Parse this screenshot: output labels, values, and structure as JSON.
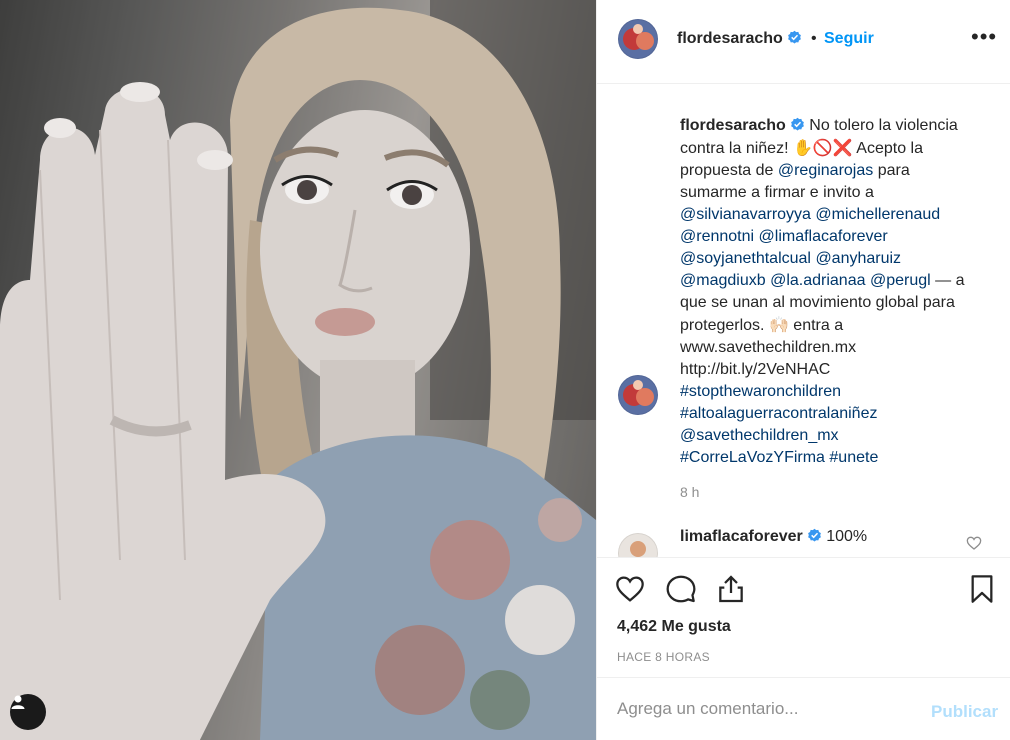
{
  "post": {
    "username": "flordesaracho",
    "separator": "•",
    "follow_label": "Seguir",
    "more_label": "•••",
    "caption": {
      "username": "flordesaracho",
      "text_1": "No tolero la violencia contra la niñez! ",
      "emoji_1": "✋🚫❌",
      "text_2": " Acepto la propuesta de ",
      "mention_1": "@reginarojas",
      "text_3": " para sumarme a firmar e invito a ",
      "mention_2": "@silvianavarroyya",
      "mention_3": "@michellerenaud",
      "mention_4": "@rennotni",
      "mention_5": "@limaflacaforever",
      "mention_6": "@soyjanethtalcual",
      "mention_7": "@anyharuiz",
      "mention_8": "@magdiuxb",
      "mention_9": "@la.adrianaa",
      "mention_10": "@perugl",
      "text_4": " — a que se unan al movimiento global para protegerlos. ",
      "emoji_2": "🙌🏻",
      "text_5": " entra a www.savethechildren.mx http://bit.ly/2VeNHAC ",
      "hashtag_1": "#stopthewaronchildren",
      "hashtag_2": "#altoalaguerracontralaniñez",
      "mention_11": "@savethechildren_mx",
      "hashtag_3": "#CorreLaVozYFirma",
      "hashtag_4": "#unete"
    },
    "caption_time": "8 h",
    "comment": {
      "username": "limaflacaforever",
      "text": "100%"
    },
    "likes": "4,462 Me gusta",
    "posted": "HACE 8 HORAS",
    "comment_placeholder": "Agrega un comentario...",
    "publish_label": "Publicar"
  },
  "icons": {
    "verified": "verified-badge-icon",
    "like": "heart-outline-icon",
    "comment": "speech-bubble-icon",
    "share": "share-upload-icon",
    "save": "bookmark-outline-icon",
    "comment_like": "small-heart-icon",
    "user_tags": "user-silhouette-icon"
  },
  "colors": {
    "link": "#00376b",
    "follow": "#0095f6",
    "publish_disabled": "#b2dffc",
    "muted": "#8e8e8e",
    "verified": "#3897f0"
  }
}
